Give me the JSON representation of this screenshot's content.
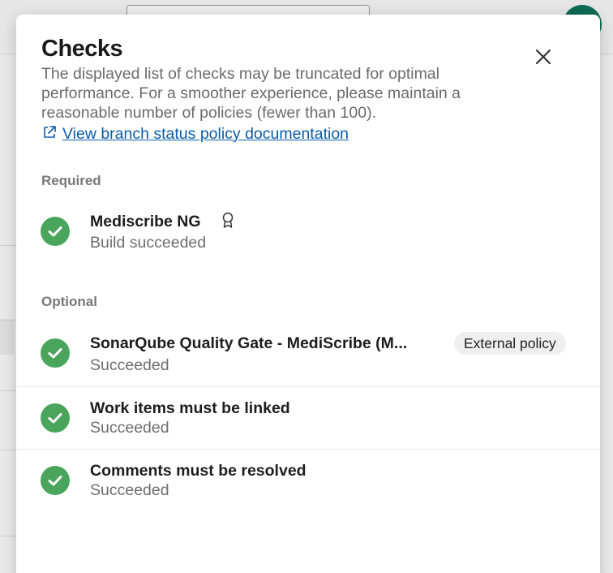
{
  "dialog": {
    "title": "Checks",
    "description": "The displayed list of checks may be truncated for optimal performance. For a smoother experience, please maintain a reasonable number of policies (fewer than 100).",
    "doc_link": "View branch status policy documentation",
    "icons": {
      "close": "close-icon",
      "external_link": "external-link-icon",
      "check": "check-circle-icon",
      "award": "award-icon"
    }
  },
  "colors": {
    "success": "#4aa55c",
    "link": "#0a5da8",
    "avatar": "#0e6b55"
  },
  "required": {
    "label": "Required",
    "items": [
      {
        "name": "Mediscribe NG",
        "status": "Build succeeded"
      }
    ]
  },
  "optional": {
    "label": "Optional",
    "items": [
      {
        "name": "SonarQube Quality Gate - MediScribe (M...",
        "status": "Succeeded",
        "badge": "External policy"
      },
      {
        "name": "Work items must be linked",
        "status": "Succeeded"
      },
      {
        "name": "Comments must be resolved",
        "status": "Succeeded"
      }
    ]
  }
}
